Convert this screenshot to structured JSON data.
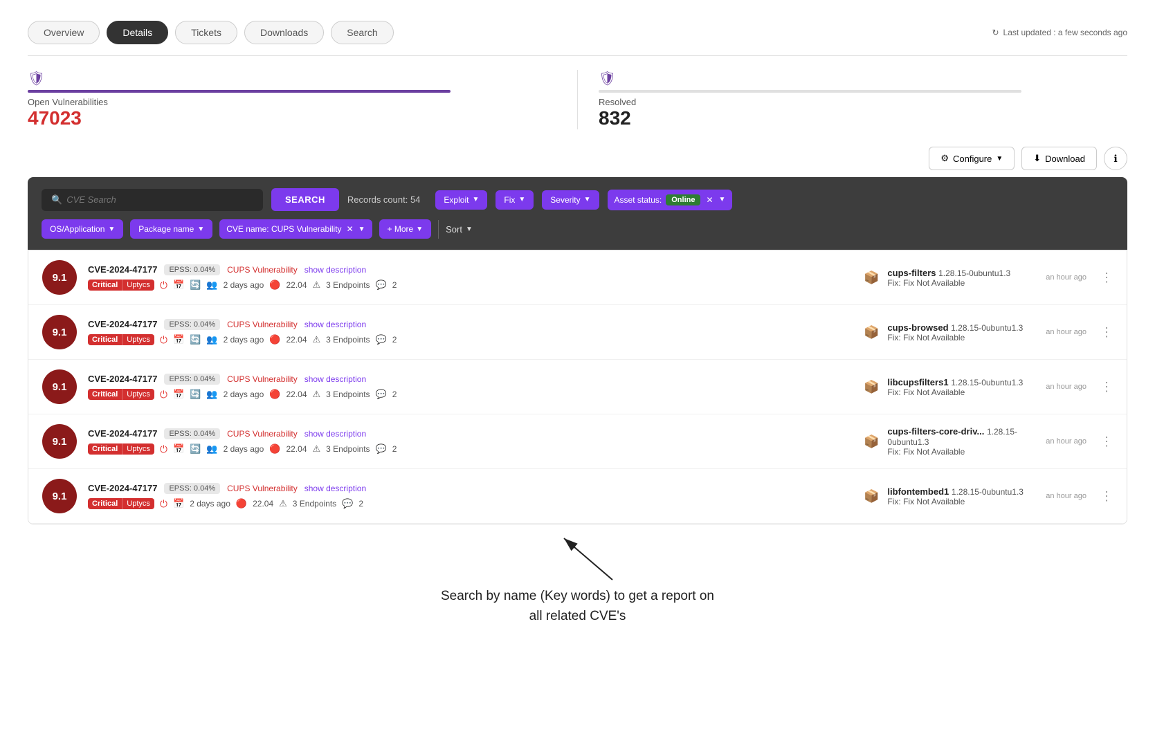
{
  "nav": {
    "tabs": [
      {
        "label": "Overview",
        "active": false
      },
      {
        "label": "Details",
        "active": true
      },
      {
        "label": "Tickets",
        "active": false
      },
      {
        "label": "Downloads",
        "active": false
      },
      {
        "label": "Search",
        "active": false
      }
    ],
    "last_updated": "Last updated : a few seconds ago"
  },
  "stats": {
    "open_label": "Open Vulnerabilities",
    "open_value": "47023",
    "resolved_label": "Resolved",
    "resolved_value": "832",
    "progress_pct": 80
  },
  "toolbar": {
    "configure_label": "Configure",
    "download_label": "Download"
  },
  "filter": {
    "search_placeholder": "CVE Search",
    "search_button": "SEARCH",
    "records_count": "Records count: 54",
    "chips": [
      {
        "label": "Exploit",
        "has_caret": true
      },
      {
        "label": "Fix",
        "has_caret": true
      },
      {
        "label": "Severity",
        "has_caret": true
      }
    ],
    "asset_status_label": "Asset status:",
    "online_badge": "Online",
    "os_app_label": "OS/Application",
    "pkg_name_label": "Package name",
    "cve_name_label": "CVE name: CUPS Vulnerability",
    "more_label": "+ More",
    "sort_label": "Sort"
  },
  "cve_rows": [
    {
      "score": "9.1",
      "id": "CVE-2024-47177",
      "epss": "EPSS: 0.04%",
      "cups_label": "CUPS Vulnerability",
      "show_desc": "show description",
      "critical": "Critical",
      "uptycs": "Uptycs",
      "days_ago": "2 days ago",
      "os_version": "22.04",
      "endpoints": "3 Endpoints",
      "comments": "2",
      "pkg_name": "cups-filters",
      "pkg_version": "1.28.15-0ubuntu1.3",
      "fix": "Fix: Fix Not Available",
      "time": "an hour ago"
    },
    {
      "score": "9.1",
      "id": "CVE-2024-47177",
      "epss": "EPSS: 0.04%",
      "cups_label": "CUPS Vulnerability",
      "show_desc": "show description",
      "critical": "Critical",
      "uptycs": "Uptycs",
      "days_ago": "2 days ago",
      "os_version": "22.04",
      "endpoints": "3 Endpoints",
      "comments": "2",
      "pkg_name": "cups-browsed",
      "pkg_version": "1.28.15-0ubuntu1.3",
      "fix": "Fix: Fix Not Available",
      "time": "an hour ago"
    },
    {
      "score": "9.1",
      "id": "CVE-2024-47177",
      "epss": "EPSS: 0.04%",
      "cups_label": "CUPS Vulnerability",
      "show_desc": "show description",
      "critical": "Critical",
      "uptycs": "Uptycs",
      "days_ago": "2 days ago",
      "os_version": "22.04",
      "endpoints": "3 Endpoints",
      "comments": "2",
      "pkg_name": "libcupsfilters1",
      "pkg_version": "1.28.15-0ubuntu1.3",
      "fix": "Fix: Fix Not Available",
      "time": "an hour ago"
    },
    {
      "score": "9.1",
      "id": "CVE-2024-47177",
      "epss": "EPSS: 0.04%",
      "cups_label": "CUPS Vulnerability",
      "show_desc": "show description",
      "critical": "Critical",
      "uptycs": "Uptycs",
      "days_ago": "2 days ago",
      "os_version": "22.04",
      "endpoints": "3 Endpoints",
      "comments": "2",
      "pkg_name": "cups-filters-core-driv...",
      "pkg_version": "1.28.15-0ubuntu1.3",
      "fix": "Fix: Fix Not Available",
      "time": "an hour ago"
    },
    {
      "score": "9.1",
      "id": "CVE-2024-47177",
      "epss": "EPSS: 0.04%",
      "cups_label": "CUPS Vulnerability",
      "show_desc": "show description",
      "critical": "Critical",
      "uptycs": "Uptycs",
      "days_ago": "2 days ago",
      "os_version": "22.04",
      "endpoints": "3 Endpoints",
      "comments": "2",
      "pkg_name": "libfontembed1",
      "pkg_version": "1.28.15-0ubuntu1.3",
      "fix": "Fix: Fix Not Available",
      "time": "an hour ago"
    }
  ],
  "annotation": {
    "text": "Search by name (Key words) to get a report on\nall related CVE's"
  }
}
